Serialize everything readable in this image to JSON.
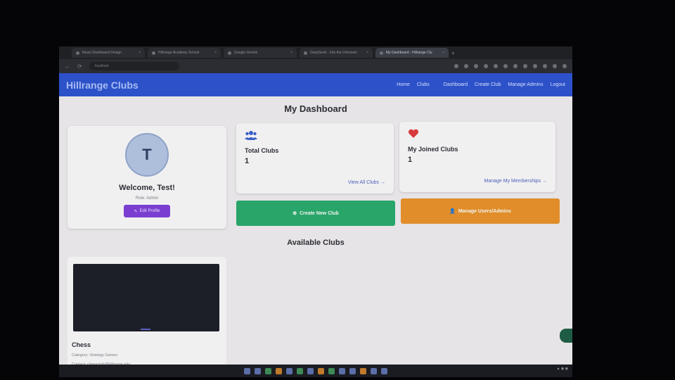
{
  "browser": {
    "tabs": [
      {
        "label": "React Dashboard Design"
      },
      {
        "label": "Hillrange Academy School"
      },
      {
        "label": "Google Gemini"
      },
      {
        "label": "DeepSeek - Into the Unknown"
      },
      {
        "label": "My Dashboard - Hillrange Clu"
      }
    ],
    "url": "localhost"
  },
  "navbar": {
    "brand": "Hillrange Clubs",
    "links": [
      "Home",
      "Clubs",
      "Dashboard",
      "Create Club",
      "Manage Admins",
      "Logout"
    ]
  },
  "page": {
    "title": "My Dashboard"
  },
  "profile": {
    "initial": "T",
    "welcome": "Welcome, Test!",
    "role": "Role: Admin",
    "edit_button": "Edit Profile"
  },
  "stats": {
    "total": {
      "icon": "users-icon",
      "label": "Total Clubs",
      "value": "1",
      "link": "View All Clubs →"
    },
    "joined": {
      "icon": "heart-icon",
      "label": "My Joined Clubs",
      "value": "1",
      "link": "Manage My Memberships →"
    }
  },
  "actions": {
    "create": "Create New Club",
    "manage": "Manage Users/Admins"
  },
  "available": {
    "title": "Available Clubs",
    "clubs": [
      {
        "name": "Chess",
        "category": "Category: Strategy Games",
        "contact": "Contact: chessclub@hillrange.edu"
      }
    ]
  },
  "colors": {
    "navbar": "#2c51c9",
    "green": "#2aa56a",
    "orange": "#e08d2a",
    "purple": "#7a3fd0",
    "heart": "#d63a3a",
    "users": "#3b5fc8"
  }
}
